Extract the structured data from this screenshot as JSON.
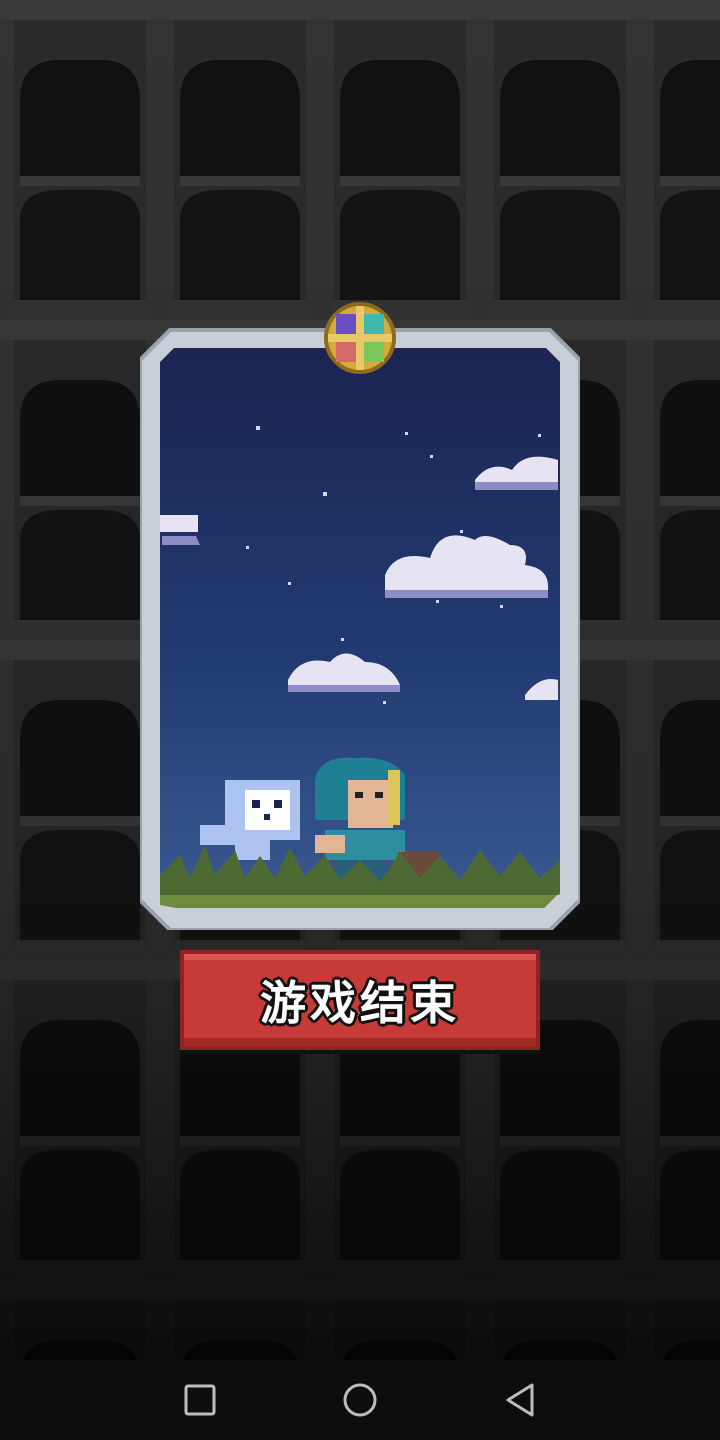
{
  "game": {
    "screen": "game-over",
    "title_banner_label": "游戏结束"
  },
  "navbar": {
    "buttons": [
      {
        "name": "recent-apps",
        "icon": "square-icon"
      },
      {
        "name": "home",
        "icon": "circle-icon"
      },
      {
        "name": "back",
        "icon": "triangle-back-icon"
      }
    ]
  },
  "colors": {
    "background": "#202020",
    "banner": "#c63b38",
    "sky_top": "#1b2452",
    "sky_bottom": "#3a5a92",
    "frame": "#c9cfd6"
  }
}
